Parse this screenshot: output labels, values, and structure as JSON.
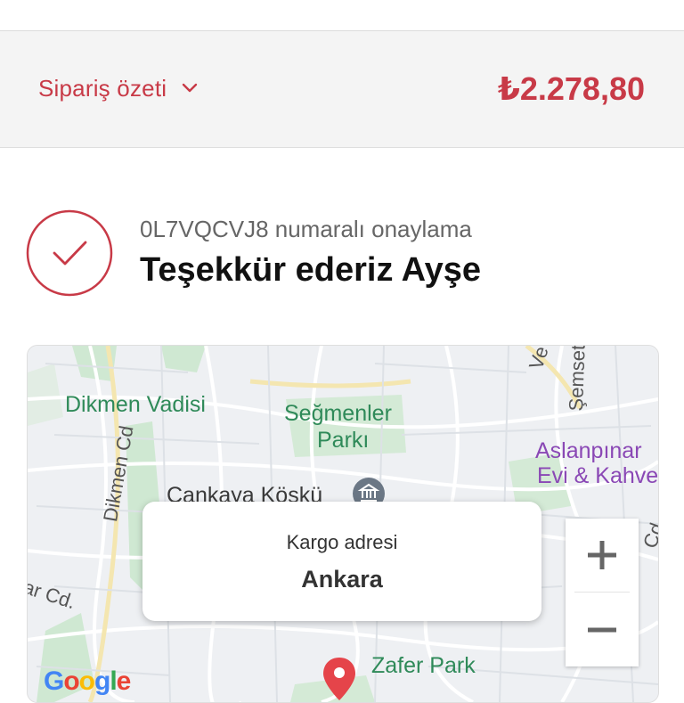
{
  "summary": {
    "label": "Sipariş özeti",
    "total": "₺2.278,80",
    "accent_color": "#c83a47",
    "chevron_icon": "chevron-down-icon"
  },
  "confirmation": {
    "number_text": "0L7VQCVJ8 numaralı onaylama",
    "title": "Teşekkür ederiz Ayşe",
    "check_icon": "check-circle-icon"
  },
  "map": {
    "labels": {
      "dikmen_vadisi": "Dikmen Vadisi",
      "segmenler": "Seğmenler",
      "parki": "Parkı",
      "aslanpinar": "Aslanpınar",
      "evi_kahve": "Evi & Kahve",
      "cankaya_kosku": "Çankaya Köşkü",
      "dikmen_cd": "Dikmen Cd",
      "semset": "Şemset",
      "ve": "Ve",
      "ar_cd": "ar Cd.",
      "cd_right": "Cd",
      "zafer_park": "Zafer Park"
    },
    "address_card": {
      "caption": "Kargo adresi",
      "value": "Ankara"
    },
    "zoom_in_symbol": "+",
    "zoom_out_symbol": "−",
    "attribution": "Google"
  }
}
